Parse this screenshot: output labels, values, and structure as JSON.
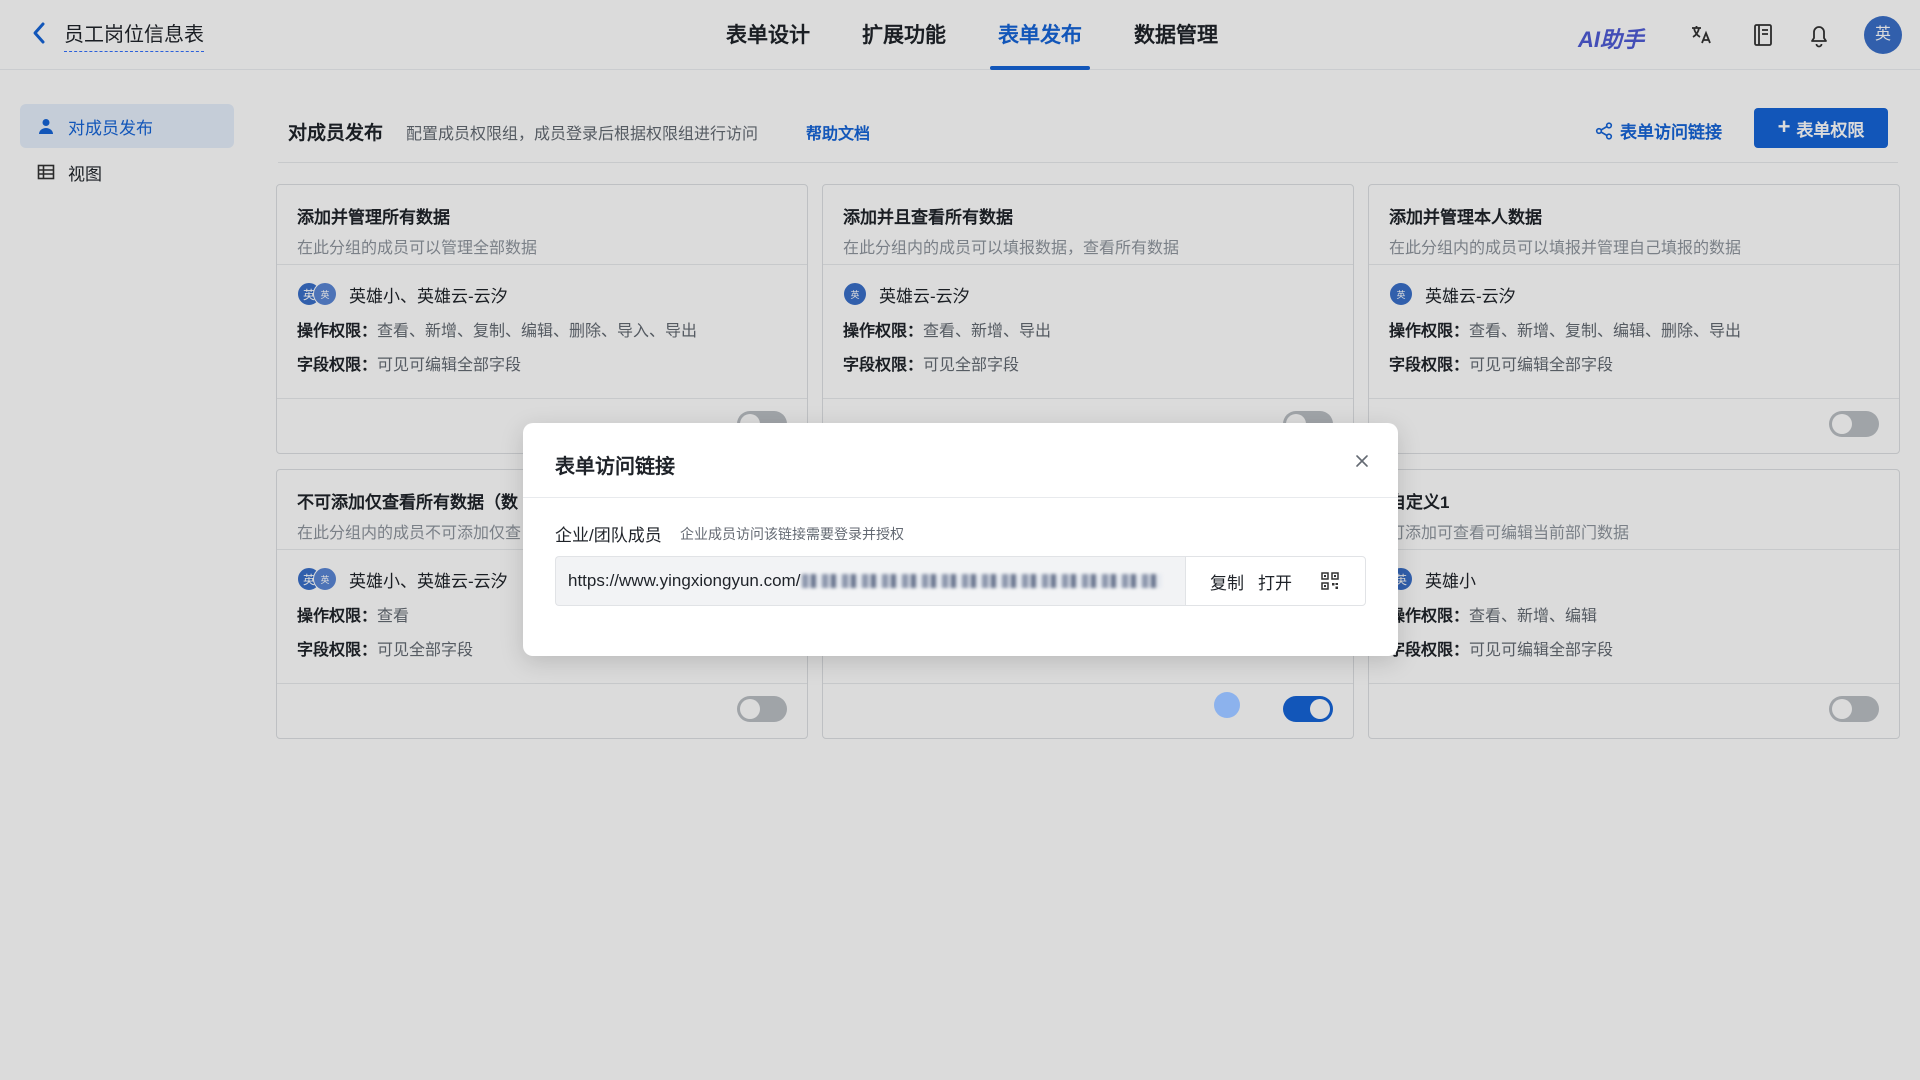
{
  "header": {
    "doc_title": "员工岗位信息表",
    "tabs": [
      "表单设计",
      "扩展功能",
      "表单发布",
      "数据管理"
    ],
    "active_tab": "表单发布",
    "ai_label": "AI助手",
    "avatar_text": "英"
  },
  "sidebar": {
    "items": [
      {
        "label": "对成员发布",
        "icon": "user-icon",
        "active": true
      },
      {
        "label": "视图",
        "icon": "table-icon",
        "active": false
      }
    ]
  },
  "main": {
    "section_title": "对成员发布",
    "section_desc": "配置成员权限组，成员登录后根据权限组进行访问",
    "help_link": "帮助文档",
    "share_link": "表单访问链接",
    "permission_button": "表单权限",
    "op_label": "操作权限：",
    "field_label": "字段权限：",
    "cards": [
      {
        "title": "添加并管理所有数据",
        "subtitle": "在此分组的成员可以管理全部数据",
        "avatars": [
          "英",
          "英"
        ],
        "members": "英雄小、英雄云-云汐",
        "ops": "查看、新增、复制、编辑、删除、导入、导出",
        "fields": "可见可编辑全部字段",
        "enabled": false
      },
      {
        "title": "添加并且查看所有数据",
        "subtitle": "在此分组内的成员可以填报数据，查看所有数据",
        "avatars": [
          "英"
        ],
        "members": "英雄云-云汐",
        "ops": "查看、新增、导出",
        "fields": "可见全部字段",
        "enabled": false
      },
      {
        "title": "添加并管理本人数据",
        "subtitle": "在此分组内的成员可以填报并管理自己填报的数据",
        "avatars": [
          "英"
        ],
        "members": "英雄云-云汐",
        "ops": "查看、新增、复制、编辑、删除、导出",
        "fields": "可见可编辑全部字段",
        "enabled": false
      },
      {
        "title": "不可添加仅查看所有数据（数",
        "subtitle": "在此分组内的成员不可添加仅查",
        "avatars": [
          "英",
          "英"
        ],
        "members": "英雄小、英雄云-云汐",
        "ops": "查看",
        "fields": "可见全部字段",
        "enabled": false
      },
      {
        "title": "",
        "subtitle": "",
        "avatars": [],
        "members": "",
        "ops": "",
        "fields": "",
        "enabled": true
      },
      {
        "title": "自定义1",
        "subtitle": "可添加可查看可编辑当前部门数据",
        "avatars": [
          "英"
        ],
        "members": "英雄小",
        "ops": "查看、新增、编辑",
        "fields": "可见可编辑全部字段",
        "enabled": false
      }
    ]
  },
  "modal": {
    "title": "表单访问链接",
    "label": "企业/团队成员",
    "hint": "企业成员访问该链接需要登录并授权",
    "url": "https://www.yingxiongyun.com/",
    "copy": "复制",
    "open": "打开"
  },
  "colors": {
    "accent": "#1665d8",
    "avatar": "#3a6fc9",
    "ai": "#4f5bd5"
  }
}
